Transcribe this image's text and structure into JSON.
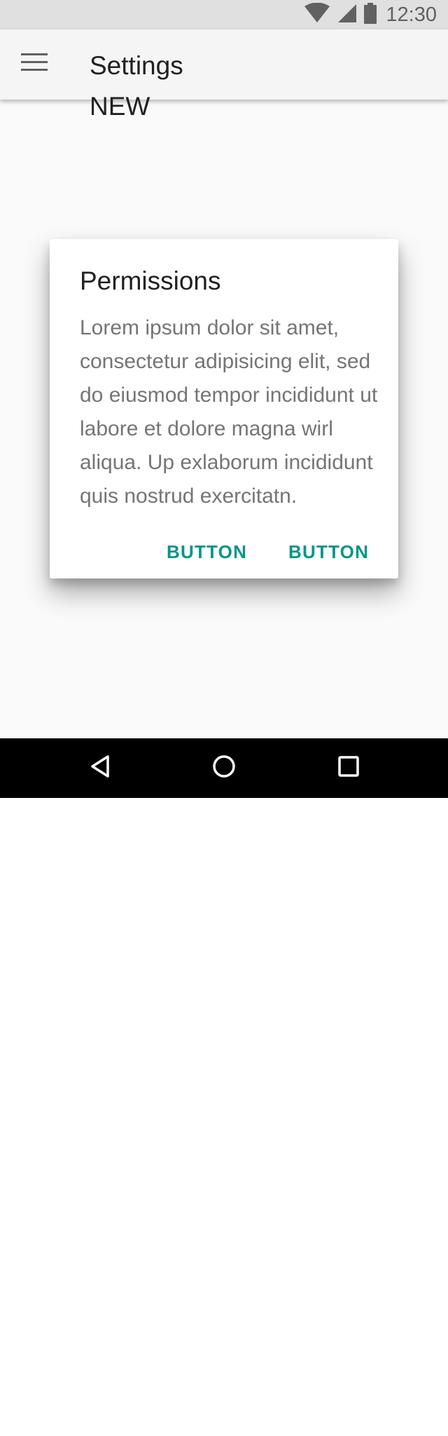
{
  "status_bar": {
    "time": "12:30",
    "icons": [
      "wifi-icon",
      "signal-icon",
      "battery-icon"
    ]
  },
  "app_bar": {
    "menu_icon": "menu-icon",
    "title": "Settings",
    "subtitle": "NEW"
  },
  "dialog": {
    "title": "Permissions",
    "body": "Lorem ipsum dolor sit amet, consectetur adipisicing elit, sed do eiusmod tempor incididunt ut labore et dolore magna wirl aliqua. Up exlaborum incididunt quis nostrud exercitatn.",
    "buttons": [
      {
        "label": "BUTTON"
      },
      {
        "label": "BUTTON"
      }
    ]
  },
  "nav_bar": {
    "icons": [
      "back-icon",
      "home-icon",
      "recents-icon"
    ]
  },
  "colors": {
    "accent": "#009688",
    "status_bar_bg": "#e0e0e0",
    "app_bar_bg": "#f5f5f5",
    "nav_bar_bg": "#000000"
  }
}
